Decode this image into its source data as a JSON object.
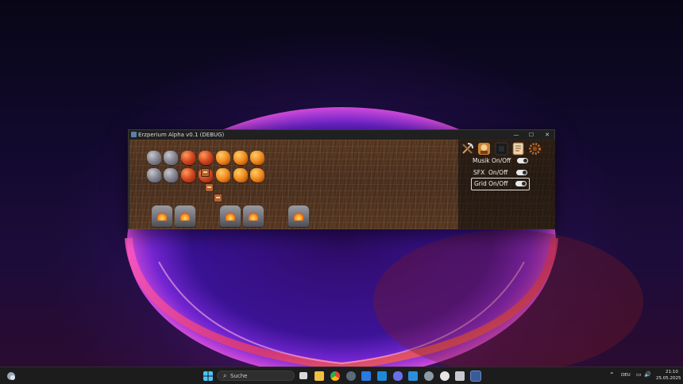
{
  "window": {
    "title": "Erzperium Alpha v0.1 (DEBUG)",
    "minimize_glyph": "—",
    "maximize_glyph": "☐",
    "close_glyph": "✕"
  },
  "settings_panel": {
    "tools": [
      {
        "icon": "pickaxe-icon"
      },
      {
        "icon": "character-icon"
      },
      {
        "icon": "dark-tile-icon"
      },
      {
        "icon": "note-icon"
      },
      {
        "icon": "gear-icon"
      }
    ],
    "toggles": [
      {
        "label": "Musik On/Off",
        "state": "on"
      },
      {
        "label": "SFX  On/Off",
        "state": "on"
      },
      {
        "label": "Grid On/Off",
        "state": "on",
        "selected": true
      }
    ]
  },
  "taskbar": {
    "search_placeholder": "Suche",
    "apps": [
      "start-icon",
      "search-icon",
      "task-view-icon",
      "file-explorer-icon",
      "chrome-icon",
      "settings-icon",
      "arrow-app-icon",
      "vscode-icon",
      "discord-icon",
      "docker-icon",
      "gear-app-icon",
      "chatgpt-icon",
      "editor-icon",
      "game-icon"
    ],
    "tray": {
      "language": "DEU",
      "time": "21:10",
      "date": "25.05.2025"
    }
  },
  "colors": {
    "accent": "#5a7fa8",
    "wallpaper_glow": "#b03ad0",
    "board": "#5a3a22"
  }
}
